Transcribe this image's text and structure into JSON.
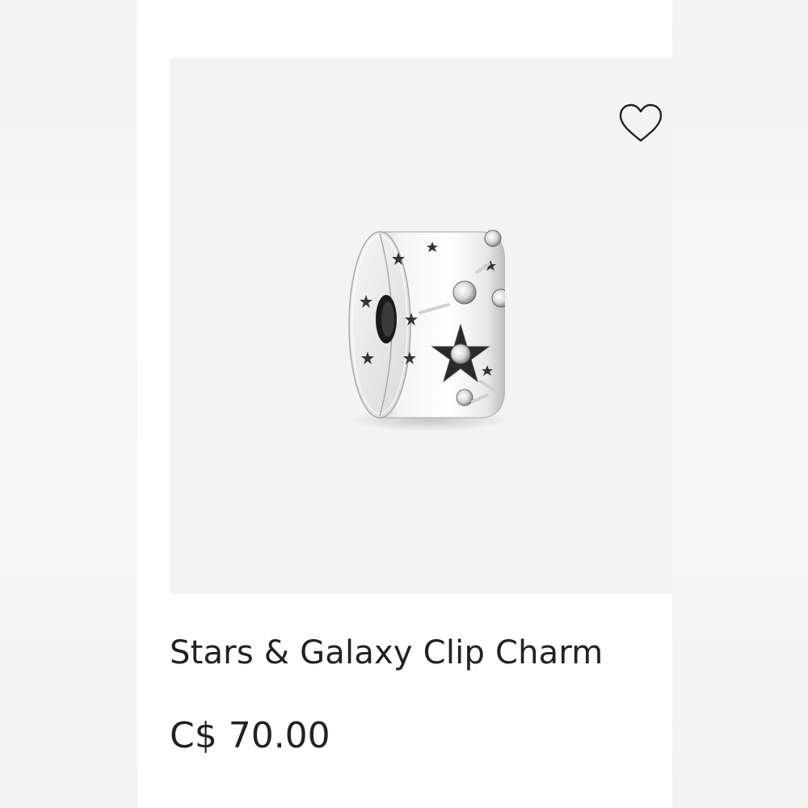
{
  "product": {
    "title": "Stars & Galaxy Clip Charm",
    "price": "C$ 70.00",
    "image_icon": "silver-clip-charm-with-stars",
    "wishlist_icon": "heart-outline-icon"
  },
  "colors": {
    "text": "#222222",
    "image_background": "#f3f3f3",
    "page_background": "#ffffff"
  }
}
